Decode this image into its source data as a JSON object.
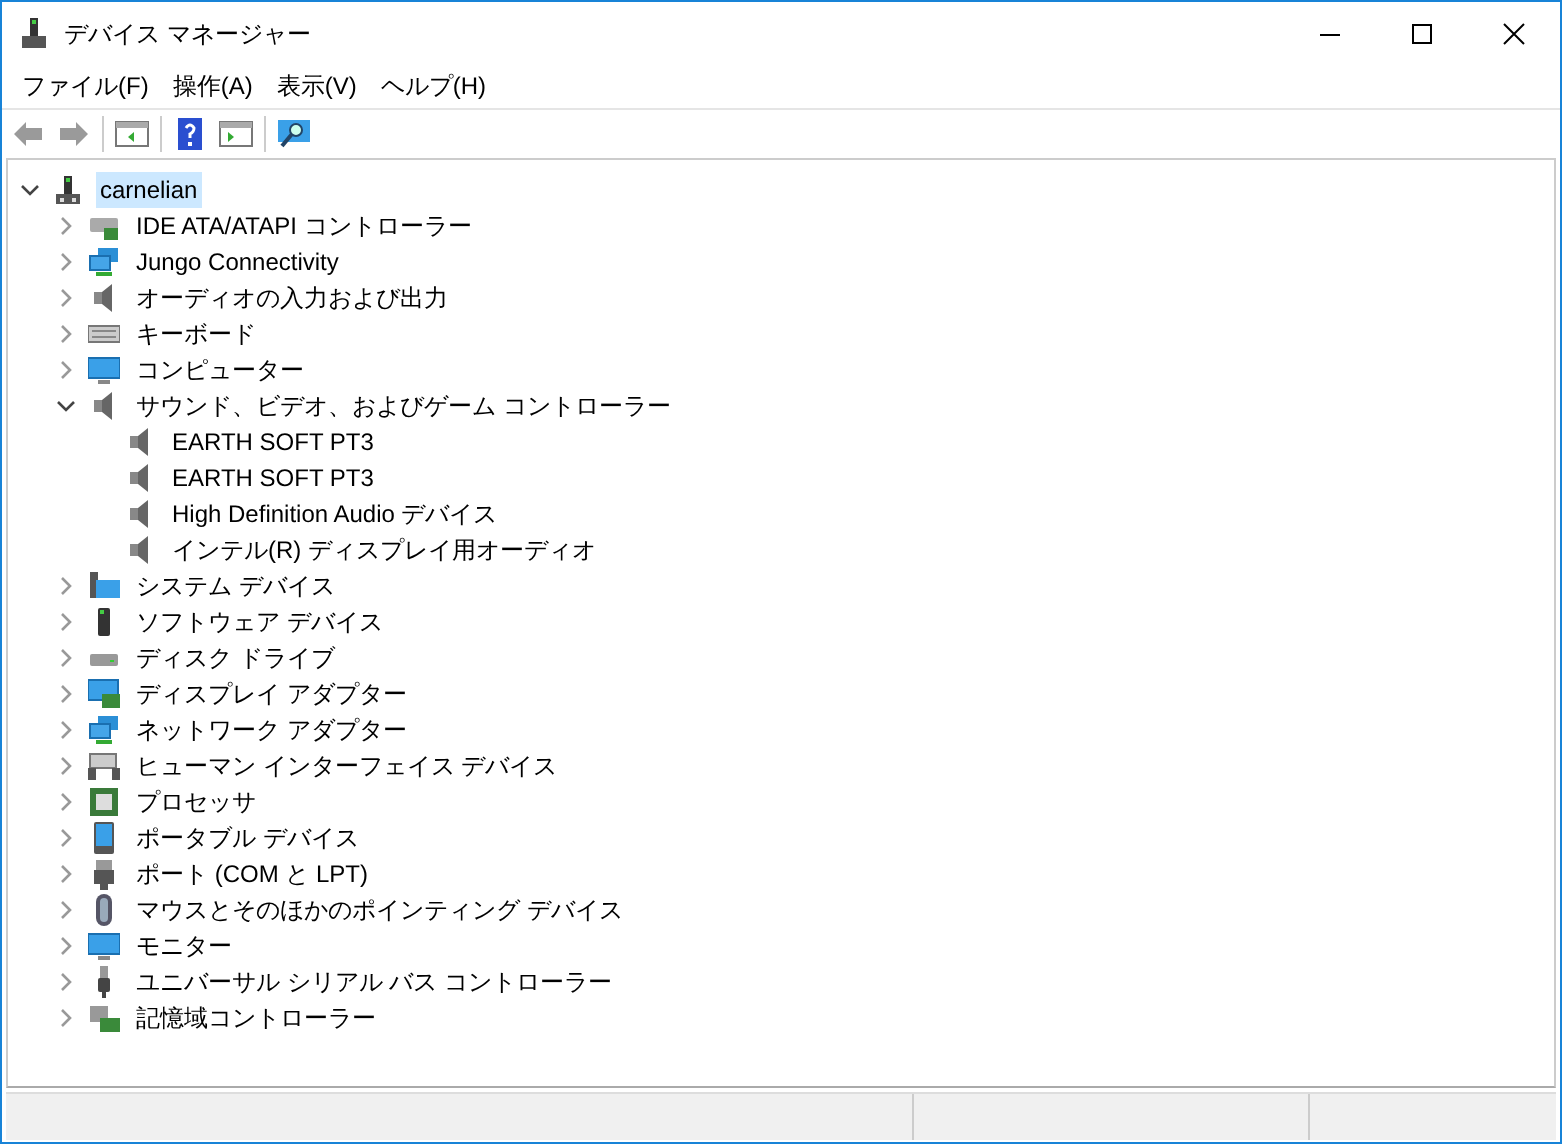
{
  "window": {
    "title": "デバイス マネージャー"
  },
  "menu": [
    "ファイル(F)",
    "操作(A)",
    "表示(V)",
    "ヘルプ(H)"
  ],
  "tree": {
    "label": "carnelian",
    "expanded": true,
    "selected": true,
    "children": [
      {
        "label": "IDE ATA/ATAPI コントローラー",
        "kind": "controller",
        "expanded": false
      },
      {
        "label": "Jungo Connectivity",
        "kind": "network",
        "expanded": false
      },
      {
        "label": "オーディオの入力および出力",
        "kind": "speaker",
        "expanded": false
      },
      {
        "label": "キーボード",
        "kind": "keyboard",
        "expanded": false
      },
      {
        "label": "コンピューター",
        "kind": "monitor",
        "expanded": false
      },
      {
        "label": "サウンド、ビデオ、およびゲーム コントローラー",
        "kind": "speaker",
        "expanded": true,
        "children": [
          {
            "label": "EARTH SOFT PT3",
            "kind": "speaker"
          },
          {
            "label": "EARTH SOFT PT3",
            "kind": "speaker"
          },
          {
            "label": "High Definition Audio デバイス",
            "kind": "speaker"
          },
          {
            "label": "インテル(R) ディスプレイ用オーディオ",
            "kind": "speaker"
          }
        ]
      },
      {
        "label": "システム デバイス",
        "kind": "system",
        "expanded": false
      },
      {
        "label": "ソフトウェア デバイス",
        "kind": "software",
        "expanded": false
      },
      {
        "label": "ディスク ドライブ",
        "kind": "disk",
        "expanded": false
      },
      {
        "label": "ディスプレイ アダプター",
        "kind": "display",
        "expanded": false
      },
      {
        "label": "ネットワーク アダプター",
        "kind": "network",
        "expanded": false
      },
      {
        "label": "ヒューマン インターフェイス デバイス",
        "kind": "hid",
        "expanded": false
      },
      {
        "label": "プロセッサ",
        "kind": "cpu",
        "expanded": false
      },
      {
        "label": "ポータブル デバイス",
        "kind": "portable",
        "expanded": false
      },
      {
        "label": "ポート (COM と LPT)",
        "kind": "port",
        "expanded": false
      },
      {
        "label": "マウスとそのほかのポインティング デバイス",
        "kind": "mouse",
        "expanded": false
      },
      {
        "label": "モニター",
        "kind": "monitor",
        "expanded": false
      },
      {
        "label": "ユニバーサル シリアル バス コントローラー",
        "kind": "usb",
        "expanded": false
      },
      {
        "label": "記憶域コントローラー",
        "kind": "storage",
        "expanded": false
      }
    ]
  }
}
